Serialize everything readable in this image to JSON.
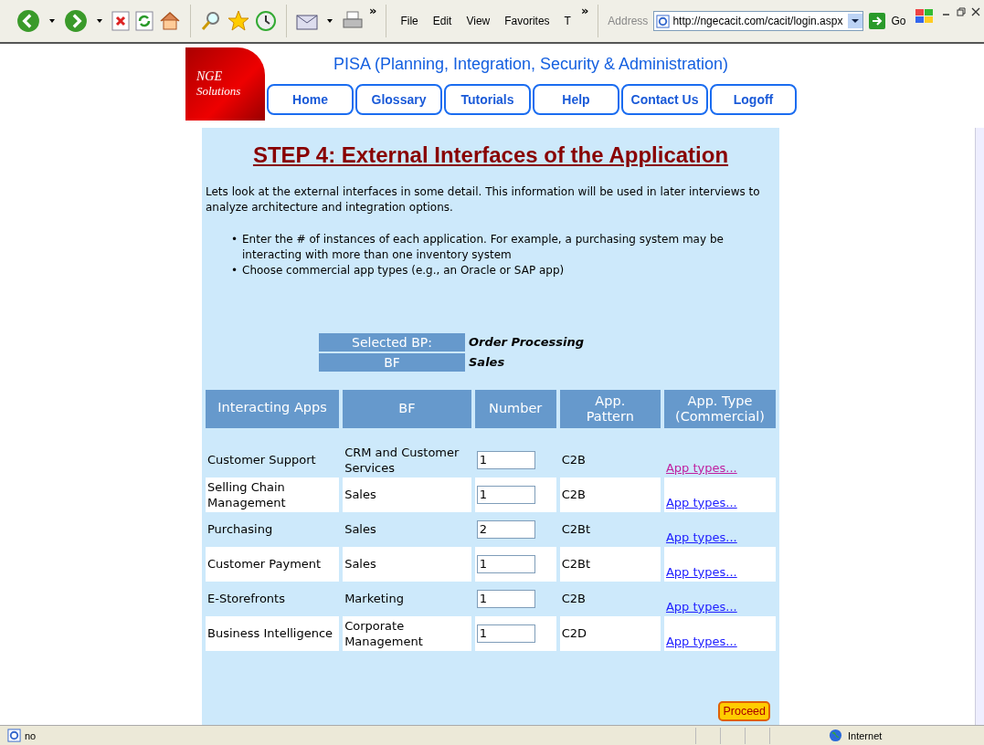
{
  "toolbar": {
    "chevron": "»",
    "menu": [
      "File",
      "Edit",
      "View",
      "Favorites",
      "T"
    ],
    "menu_chevron": "»",
    "address_label": "Address",
    "address": "http://ngecacit.com/cacit/login.aspx",
    "go": "Go"
  },
  "logo": {
    "line1": "NGE",
    "line2": "Solutions"
  },
  "site_title": "PISA (Planning, Integration, Security & Administration)",
  "nav": [
    "Home",
    "Glossary",
    "Tutorials",
    "Help",
    "Contact Us",
    "Logoff"
  ],
  "heading": "STEP 4: External Interfaces of the Application",
  "intro": "Lets look at the external interfaces in some detail. This information will be used in later interviews to analyze architecture and integration options.",
  "bullets": [
    {
      "marker": "•",
      "text": "Enter the # of instances of each application. For example, a purchasing system may be interacting with more than one inventory system"
    },
    {
      "marker": "•",
      "text": "Choose commercial app types (e.g., an Oracle or SAP app)"
    }
  ],
  "selection": [
    {
      "label": "Selected BP:",
      "value": "Order Processing"
    },
    {
      "label": "BF",
      "value": "Sales"
    }
  ],
  "table": {
    "columns": [
      "Interacting Apps",
      "BF",
      "Number",
      "App. Pattern",
      "App. Type (Commercial)"
    ],
    "rows": [
      {
        "app": "Customer Support",
        "bf": "CRM and Customer Services",
        "number": "1",
        "pattern": "C2B",
        "link": "App types...",
        "visited": true
      },
      {
        "app": "Selling Chain Management",
        "bf": "Sales",
        "number": "1",
        "pattern": "C2B",
        "link": "App types...",
        "visited": false
      },
      {
        "app": "Purchasing",
        "bf": "Sales",
        "number": "2",
        "pattern": "C2Bt",
        "link": "App types...",
        "visited": false
      },
      {
        "app": "Customer Payment",
        "bf": "Sales",
        "number": "1",
        "pattern": "C2Bt",
        "link": "App types...",
        "visited": false
      },
      {
        "app": "E-Storefronts",
        "bf": "Marketing",
        "number": "1",
        "pattern": "C2B",
        "link": "App types...",
        "visited": false
      },
      {
        "app": "Business Intelligence",
        "bf": "Corporate Management",
        "number": "1",
        "pattern": "C2D",
        "link": "App types...",
        "visited": false
      }
    ]
  },
  "proceed": "Proceed",
  "status_bar": {
    "text": "no",
    "zone": "Internet"
  }
}
